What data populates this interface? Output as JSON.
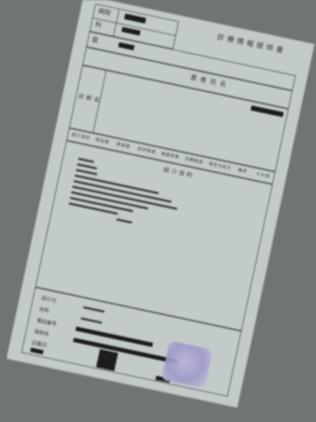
{
  "document": {
    "title": "診療情報提供書",
    "header_labels": [
      "病院",
      "科",
      "医"
    ],
    "patient_name_label": "患者氏名",
    "section_label": "診断名",
    "middle_row_labels": [
      "紹介目的",
      "既往歴",
      "家族歴",
      "症状経過",
      "検査結果",
      "治療経過",
      "現在の処方",
      "備考",
      "その他"
    ],
    "body_heading": "紹介目的",
    "footer_labels": [
      "紹介元",
      "住所",
      "電話番号",
      "医師名",
      "記載日"
    ],
    "stamp_color": "#9d98c8",
    "paper_color": "#c3cbca",
    "ink_color": "#1b1d1f"
  }
}
